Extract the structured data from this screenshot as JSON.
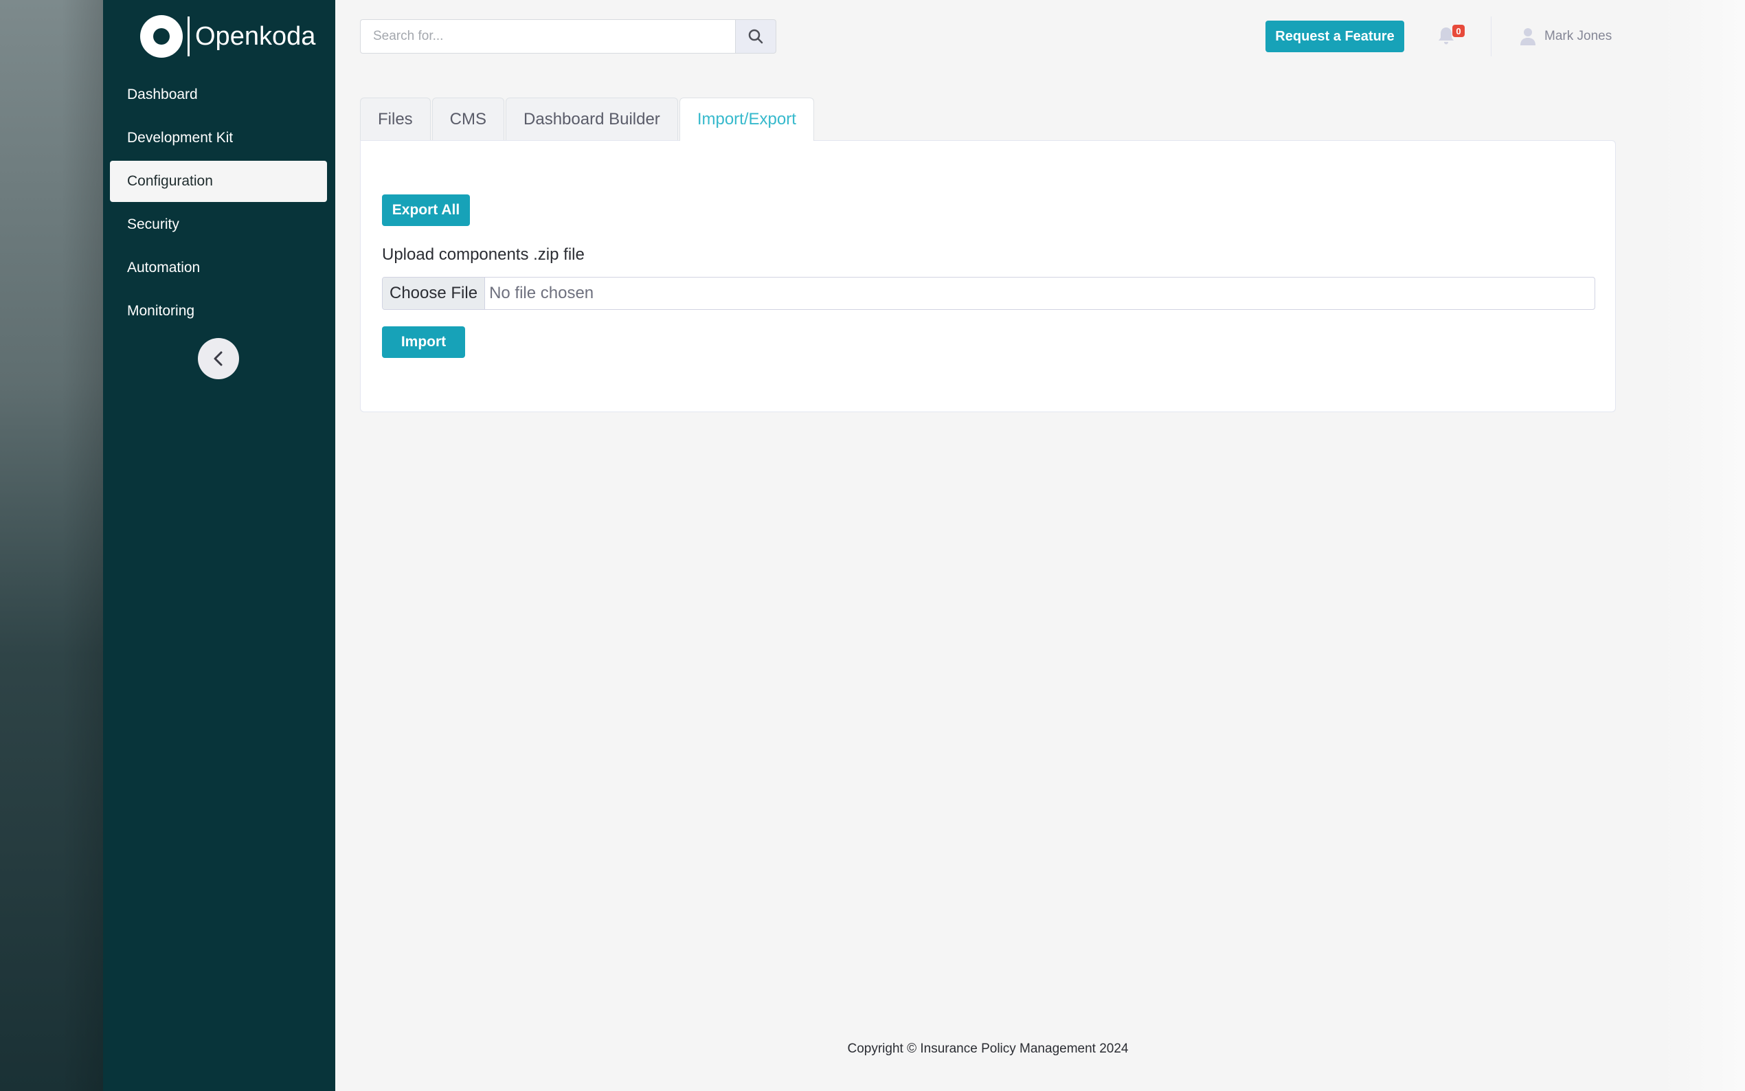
{
  "brand": {
    "name": "Openkoda"
  },
  "sidebar": {
    "items": [
      {
        "label": "Dashboard",
        "active": false
      },
      {
        "label": "Development Kit",
        "active": false
      },
      {
        "label": "Configuration",
        "active": true
      },
      {
        "label": "Security",
        "active": false
      },
      {
        "label": "Automation",
        "active": false
      },
      {
        "label": "Monitoring",
        "active": false
      }
    ],
    "collapse_icon": "chevron-left-icon"
  },
  "topbar": {
    "search_placeholder": "Search for...",
    "search_icon": "search-icon",
    "feature_button": "Request a Feature",
    "notifications_count": "0",
    "user_name": "Mark Jones"
  },
  "tabs": [
    {
      "label": "Files",
      "active": false
    },
    {
      "label": "CMS",
      "active": false
    },
    {
      "label": "Dashboard Builder",
      "active": false
    },
    {
      "label": "Import/Export",
      "active": true
    }
  ],
  "import_export": {
    "export_all_label": "Export All",
    "upload_label": "Upload components .zip file",
    "choose_file_label": "Choose File",
    "file_status": "No file chosen",
    "import_label": "Import"
  },
  "footer": {
    "copyright": "Copyright © Insurance Policy Management 2024"
  },
  "colors": {
    "sidebar": "#08343a",
    "accent": "#17a2b8",
    "active_tab_text": "#36b9cc",
    "badge": "#e74a3b"
  }
}
